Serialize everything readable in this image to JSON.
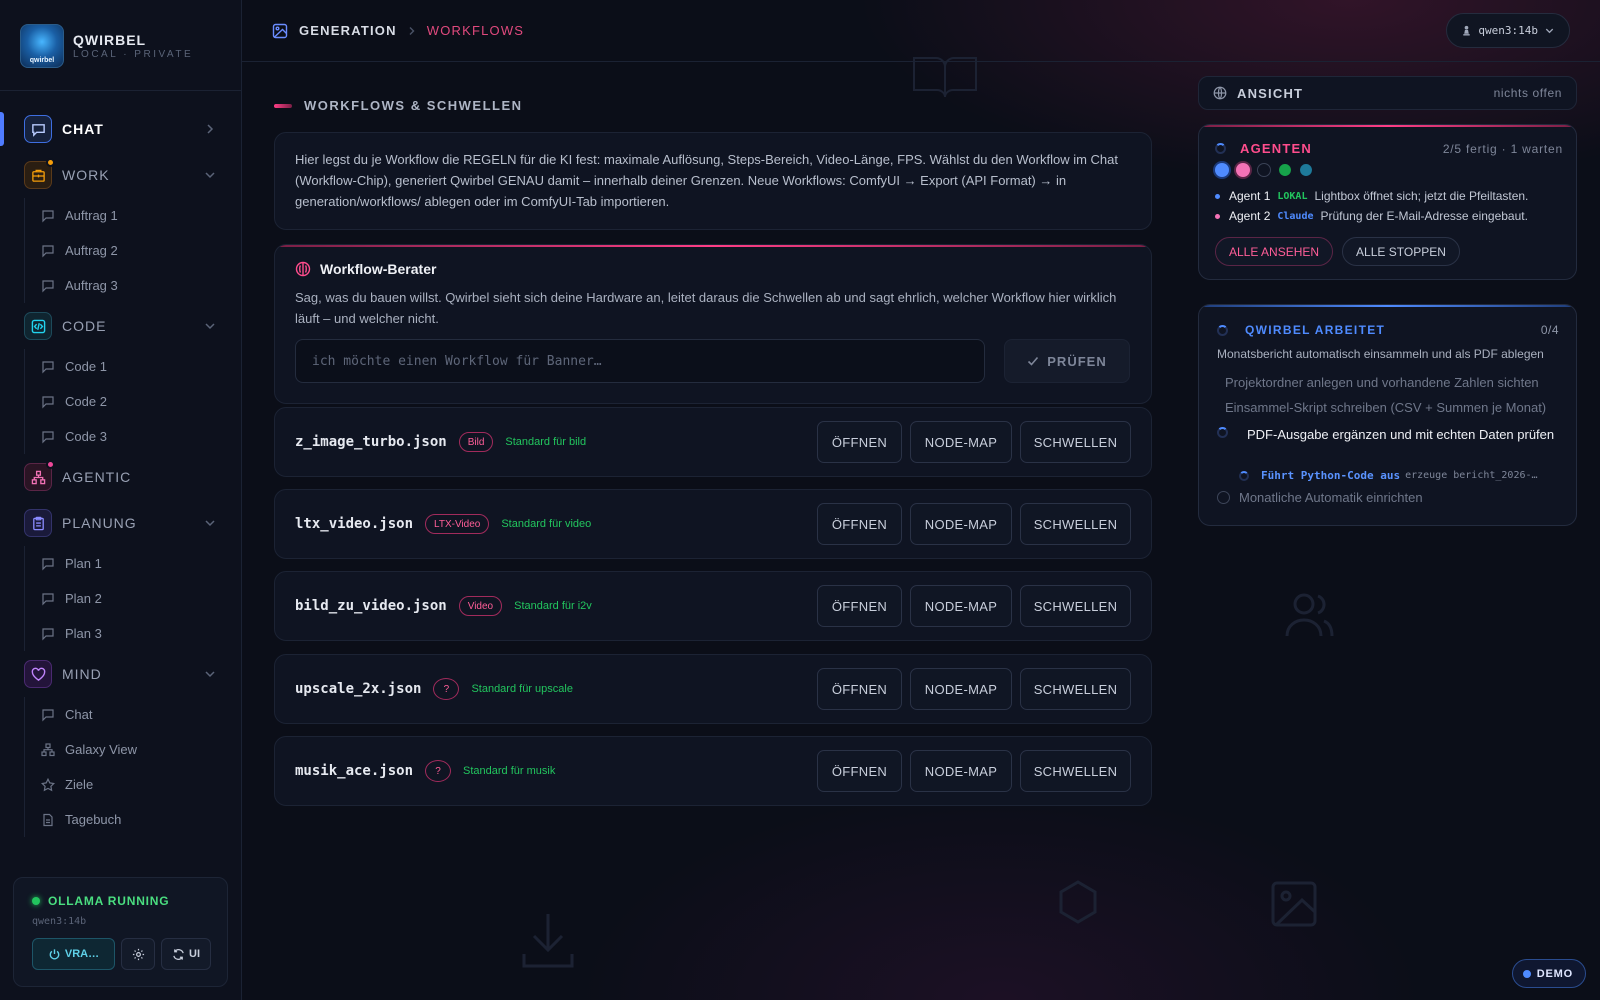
{
  "brand": {
    "name": "QWIRBEL",
    "subtitle": "LOCAL · PRIVATE",
    "logo_text": "qwirbel"
  },
  "sidebar": {
    "sections": [
      {
        "label": "CHAT",
        "icon": "chat-icon",
        "active": true,
        "items": []
      },
      {
        "label": "WORK",
        "icon": "briefcase-icon",
        "badge_color": "#f59e0b",
        "items": [
          "Auftrag 1",
          "Auftrag 2",
          "Auftrag 3"
        ]
      },
      {
        "label": "CODE",
        "icon": "code-icon",
        "items": [
          "Code 1",
          "Code 2",
          "Code 3"
        ]
      },
      {
        "label": "AGENTIC",
        "icon": "network-icon",
        "badge_color": "#ec4899",
        "items": []
      },
      {
        "label": "PLANUNG",
        "icon": "clipboard-icon",
        "items": [
          "Plan 1",
          "Plan 2",
          "Plan 3"
        ]
      },
      {
        "label": "MIND",
        "icon": "heart-icon",
        "items": [
          "Chat",
          "Galaxy View",
          "Ziele",
          "Tagebuch"
        ]
      }
    ],
    "status": {
      "label": "OLLAMA RUNNING",
      "model": "qwen3:14b",
      "power_label": "VRA…",
      "ui_label": "UI"
    }
  },
  "header": {
    "crumb_1": "GENERATION",
    "crumb_2": "WORKFLOWS",
    "model": "qwen3:14b"
  },
  "main": {
    "section_title": "WORKFLOWS & SCHWELLEN",
    "info": "Hier legst du je Workflow die REGELN für die KI fest: maximale Auflösung, Steps-Bereich, Video-Länge, FPS. Wählst du den Workflow im Chat (Workflow-Chip), generiert Qwirbel GENAU damit – innerhalb deiner Grenzen. Neue Workflows: ComfyUI → Export (API Format) → in generation/workflows/ ablegen oder im ComfyUI-Tab importieren.",
    "advisor": {
      "title": "Workflow-Berater",
      "description": "Sag, was du bauen willst. Qwirbel sieht sich deine Hardware an, leitet daraus die Schwellen ab und sagt ehrlich, welcher Workflow hier wirklich läuft – und welcher nicht.",
      "placeholder": "ich möchte einen Workflow für Banner…",
      "button": "PRÜFEN"
    },
    "button_labels": {
      "open": "ÖFFNEN",
      "node_map": "NODE-MAP",
      "thresholds": "SCHWELLEN"
    },
    "workflows": [
      {
        "file": "z_image_turbo.json",
        "tag": "Bild",
        "standard": "Standard für bild"
      },
      {
        "file": "ltx_video.json",
        "tag": "LTX-Video",
        "standard": "Standard für video"
      },
      {
        "file": "bild_zu_video.json",
        "tag": "Video",
        "standard": "Standard für i2v"
      },
      {
        "file": "upscale_2x.json",
        "tag": "?",
        "standard": "Standard für upscale"
      },
      {
        "file": "musik_ace.json",
        "tag": "?",
        "standard": "Standard für musik"
      }
    ]
  },
  "right": {
    "ansicht": {
      "label": "ANSICHT",
      "value": "nichts offen"
    },
    "agents": {
      "title": "AGENTEN",
      "count": "2/5 fertig · 1 warten",
      "dot_colors": [
        "#4f8bff",
        "#f472b6",
        "#1a2030",
        "#16a34a",
        "#1e7a9a"
      ],
      "lines": [
        {
          "name": "Agent 1",
          "tag": "LOKAL",
          "tag_color": "#22c55e",
          "bullet_color": "#4f8bff",
          "message": "Lightbox öffnet sich; jetzt die Pfeiltasten."
        },
        {
          "name": "Agent 2",
          "tag": "Claude",
          "tag_color": "#4f8bff",
          "bullet_color": "#f472b6",
          "message": "Prüfung der E-Mail-Adresse eingebaut."
        }
      ],
      "view_all": "ALLE ANSEHEN",
      "stop_all": "ALLE STOPPEN"
    },
    "working": {
      "title": "QWIRBEL ARBEITET",
      "count": "0/4",
      "description": "Monatsbericht automatisch einsammeln und als PDF ablegen",
      "steps": [
        "Projektordner anlegen und vorhandene Zahlen sichten",
        "Einsammel-Skript schreiben (CSV + Summen je Monat)",
        "PDF-Ausgabe ergänzen und mit echten Daten prüfen",
        "Monatliche Automatik einrichten"
      ],
      "sub_action": "Führt Python-Code aus",
      "sub_detail": "erzeuge bericht_2026-…"
    }
  },
  "demo": {
    "label": "DEMO"
  }
}
